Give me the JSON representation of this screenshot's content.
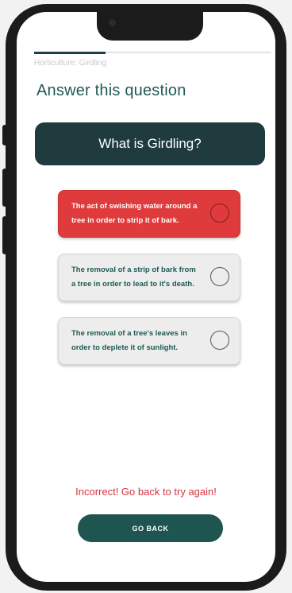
{
  "progress": {
    "fraction": 0.3
  },
  "breadcrumb": "Horticulture: Girdling",
  "page_title": "Answer this question",
  "question": "What is Girdling?",
  "options": [
    {
      "label": "The act of swishing water around a tree in order to strip it of bark.",
      "state": "incorrect"
    },
    {
      "label": "The removal of a strip of bark from a tree in order to lead to it's death.",
      "state": "unselected"
    },
    {
      "label": "The removal of a tree's leaves in order to deplete it of sunlight.",
      "state": "unselected"
    }
  ],
  "feedback": "Incorrect! Go back to try again!",
  "go_back_label": "GO BACK",
  "colors": {
    "primary": "#1f5550",
    "incorrect": "#e03b3c",
    "feedback_text": "#d8333e"
  }
}
